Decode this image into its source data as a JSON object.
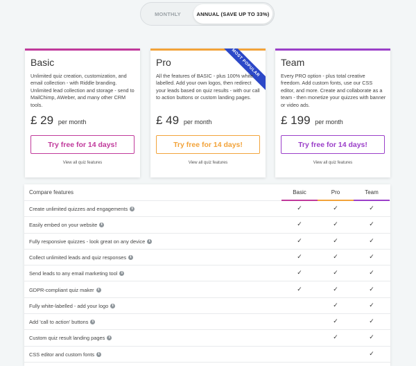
{
  "billing_toggle": {
    "monthly_label": "MONTHLY",
    "annual_label": "ANNUAL (SAVE UP TO 33%)",
    "selected": "annual"
  },
  "plans": [
    {
      "name": "Basic",
      "accent": "#c0399b",
      "description": "Unlimited quiz creation, customization, and email collection - with Riddle branding. Unlimited lead collection and storage - send to MailChimp, AWeber, and many other CRM tools.",
      "price": "£ 29",
      "period": "per month",
      "cta": "Try free for 14 days!",
      "features_link": "View all quiz features"
    },
    {
      "name": "Pro",
      "accent": "#f2a33a",
      "ribbon": "MOST POPULAR",
      "description": "All the features of BASIC - plus 100% white labelled. Add your own logos, then redirect your leads based on quiz results - with our call to action buttons or custom landing pages.",
      "price": "£ 49",
      "period": "per month",
      "cta": "Try free for 14 days!",
      "features_link": "View all quiz features"
    },
    {
      "name": "Team",
      "accent": "#9b3fc9",
      "description": "Every PRO option - plus total creative freedom. Add custom fonts, use our CSS editor, and more. Create and collaborate as a team - then monetize your quizzes with banner or video ads.",
      "price": "£ 199",
      "period": "per month",
      "cta": "Try free for 14 days!",
      "features_link": "View all quiz features"
    }
  ],
  "compare": {
    "title": "Compare features",
    "columns": [
      "Basic",
      "Pro",
      "Team"
    ],
    "check_glyph": "✓",
    "rows": [
      {
        "label": "Create unlimited quizzes and engagements",
        "info": true,
        "basic": true,
        "pro": true,
        "team": true
      },
      {
        "label": "Easily embed on your website",
        "info": true,
        "basic": true,
        "pro": true,
        "team": true
      },
      {
        "label": "Fully responsive quizzes - look great on any device",
        "info": true,
        "basic": true,
        "pro": true,
        "team": true
      },
      {
        "label": "Collect unlimited leads and quiz responses",
        "info": true,
        "basic": true,
        "pro": true,
        "team": true
      },
      {
        "label": "Send leads to any email marketing tool",
        "info": true,
        "basic": true,
        "pro": true,
        "team": true
      },
      {
        "label": "GDPR-compliant quiz maker",
        "info": true,
        "basic": true,
        "pro": true,
        "team": true
      },
      {
        "label": "Fully white-labelled - add your logo",
        "info": true,
        "basic": false,
        "pro": true,
        "team": true
      },
      {
        "label": "Add 'call to action' buttons",
        "info": true,
        "basic": false,
        "pro": true,
        "team": true
      },
      {
        "label": "Custom quiz result landing pages",
        "info": true,
        "basic": false,
        "pro": true,
        "team": true
      },
      {
        "label": "CSS editor and custom fonts",
        "info": true,
        "basic": false,
        "pro": false,
        "team": true
      }
    ]
  }
}
